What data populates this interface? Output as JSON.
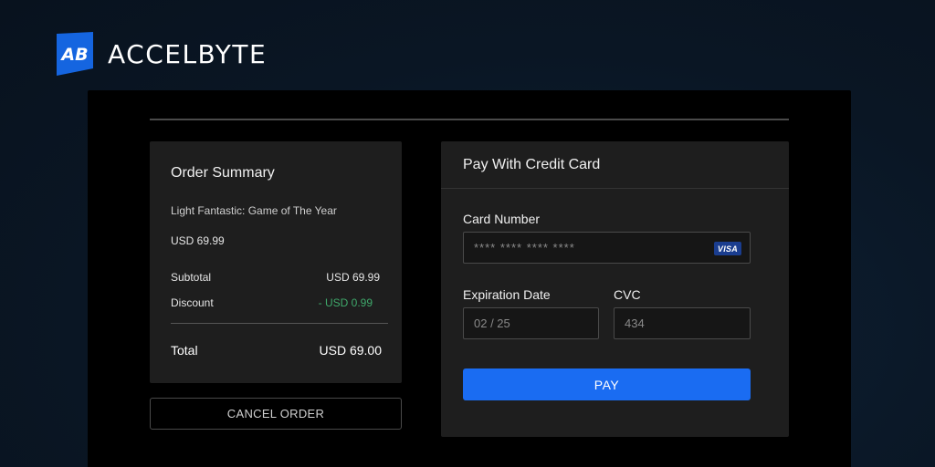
{
  "brand": {
    "name": "ACCELBYTE",
    "logo_text": "AB",
    "logo_color": "#1565e0"
  },
  "order_summary": {
    "title": "Order Summary",
    "product_name": "Light Fantastic: Game of The Year",
    "product_price": "USD 69.99",
    "subtotal_label": "Subtotal",
    "subtotal_value": "USD 69.99",
    "discount_label": "Discount",
    "discount_value": "- USD 0.99",
    "total_label": "Total",
    "total_value": "USD 69.00",
    "cancel_label": "CANCEL ORDER"
  },
  "payment": {
    "title": "Pay With Credit Card",
    "card_number_label": "Card Number",
    "card_number_placeholder": "**** **** **** ****",
    "card_brand": "VISA",
    "expiration_label": "Expiration Date",
    "expiration_placeholder": "02 / 25",
    "cvc_label": "CVC",
    "cvc_placeholder": "434",
    "pay_label": "PAY"
  },
  "colors": {
    "background": "#0b1828",
    "card": "#1e1e1e",
    "accent": "#1a6cf2",
    "discount": "#3fa96b"
  }
}
